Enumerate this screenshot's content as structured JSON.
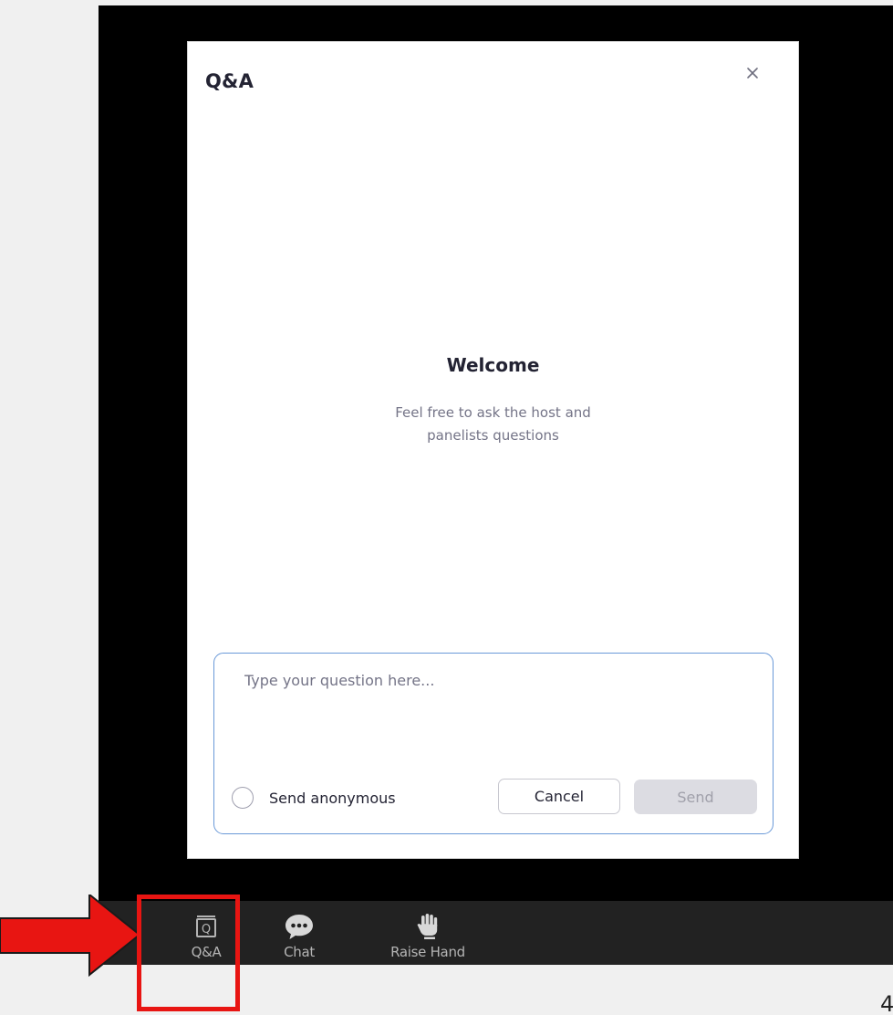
{
  "dialog": {
    "title": "Q&A",
    "close_label": "×"
  },
  "welcome": {
    "title": "Welcome",
    "subtitle_line1": "Feel free to ask the host and",
    "subtitle_line2": "panelists questions"
  },
  "question_form": {
    "placeholder": "Type your question here...",
    "value": "",
    "anonymous_label": "Send anonymous",
    "anonymous_checked": false,
    "cancel_label": "Cancel",
    "send_label": "Send"
  },
  "toolbar": {
    "items": [
      {
        "label": "Q&A",
        "icon": "qa-icon"
      },
      {
        "label": "Chat",
        "icon": "chat-icon"
      },
      {
        "label": "Raise Hand",
        "icon": "raise-hand-icon"
      }
    ]
  },
  "page_number": "4",
  "colors": {
    "annotation_red": "#e81512",
    "input_border": "#6a99d8",
    "toolbar_bg": "#222222",
    "stage_bg": "#000000"
  }
}
